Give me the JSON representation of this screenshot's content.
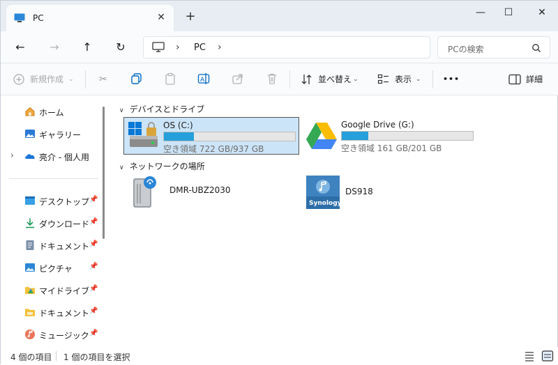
{
  "window": {
    "tab_title": "PC",
    "tab_close": "✕",
    "new_tab": "+",
    "minimize": "—",
    "maximize": "☐",
    "close": "✕"
  },
  "nav": {
    "back": "←",
    "forward": "→",
    "up": "↑",
    "refresh": "↻"
  },
  "address": {
    "chevron1": "›",
    "segment": "PC",
    "chevron2": "›"
  },
  "search": {
    "placeholder": "PCの検索"
  },
  "commands": {
    "new_label": "新規作成",
    "sort_label": "並べ替え",
    "view_label": "表示",
    "more_label": "•••",
    "details_label": "詳細"
  },
  "sidebar": {
    "items": [
      {
        "label": "ホーム",
        "icon": "home-icon"
      },
      {
        "label": "ギャラリー",
        "icon": "gallery-icon"
      },
      {
        "label": "亮介 - 個人用",
        "icon": "onedrive-icon"
      },
      {
        "label": "デスクトップ",
        "icon": "desktop-icon"
      },
      {
        "label": "ダウンロード",
        "icon": "download-icon"
      },
      {
        "label": "ドキュメント",
        "icon": "documents-icon"
      },
      {
        "label": "ピクチャ",
        "icon": "pictures-icon"
      },
      {
        "label": "マイドライブ",
        "icon": "google-drive-folder-icon"
      },
      {
        "label": "ドキュメント",
        "icon": "folder-icon"
      },
      {
        "label": "ミュージック",
        "icon": "music-icon"
      }
    ],
    "expand_chevron": "›",
    "pin_glyph": "📌"
  },
  "content": {
    "devices_header": "デバイスとドライブ",
    "network_header": "ネットワークの場所",
    "drives": [
      {
        "name": "OS (C:)",
        "free_text": "空き領域 722 GB/937 GB",
        "used_fraction": 0.23
      },
      {
        "name": "Google Drive (G:)",
        "free_text": "空き領域 161 GB/201 GB",
        "used_fraction": 0.2
      }
    ],
    "network": [
      {
        "name": "DMR-UBZ2030"
      },
      {
        "name": "DS918",
        "logo_text": "Synology"
      }
    ]
  },
  "status": {
    "item_count": "4 個の項目",
    "selected_count": "1 個の項目を選択"
  },
  "colors": {
    "accent": "#0067c0",
    "selection": "#cce4f7",
    "bar_fill": "#26a0da"
  }
}
